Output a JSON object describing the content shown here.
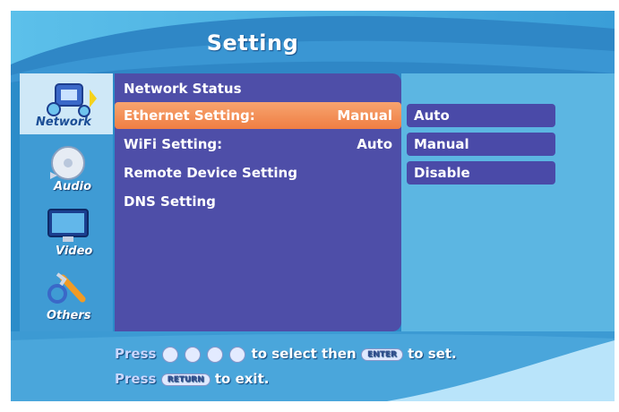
{
  "header": {
    "title": "Setting"
  },
  "sidebar": {
    "categories": [
      {
        "label": "Network",
        "icon": "network-icon",
        "selected": true
      },
      {
        "label": "Audio",
        "icon": "audio-icon",
        "selected": false
      },
      {
        "label": "Video",
        "icon": "video-icon",
        "selected": false
      },
      {
        "label": "Others",
        "icon": "others-icon",
        "selected": false
      }
    ]
  },
  "menu": {
    "items": [
      {
        "label": "Network Status",
        "value": ""
      },
      {
        "label": "Ethernet Setting:",
        "value": "Manual",
        "selected": true
      },
      {
        "label": "WiFi Setting:",
        "value": "Auto"
      },
      {
        "label": "Remote Device Setting",
        "value": ""
      },
      {
        "label": "DNS Setting",
        "value": ""
      }
    ]
  },
  "options": {
    "items": [
      "Auto",
      "Manual",
      "Disable"
    ]
  },
  "footer": {
    "line1": {
      "press": "Press",
      "middle": "to select then",
      "enter_key": "ENTER",
      "end": "to set."
    },
    "line2": {
      "press": "Press",
      "return_key": "RETURN",
      "end": "to exit."
    }
  },
  "colors": {
    "background": "#2b8cc9",
    "menu_panel": "#4e4ea8",
    "highlight": "#ef7e43",
    "option_box": "#4a4aa8"
  }
}
